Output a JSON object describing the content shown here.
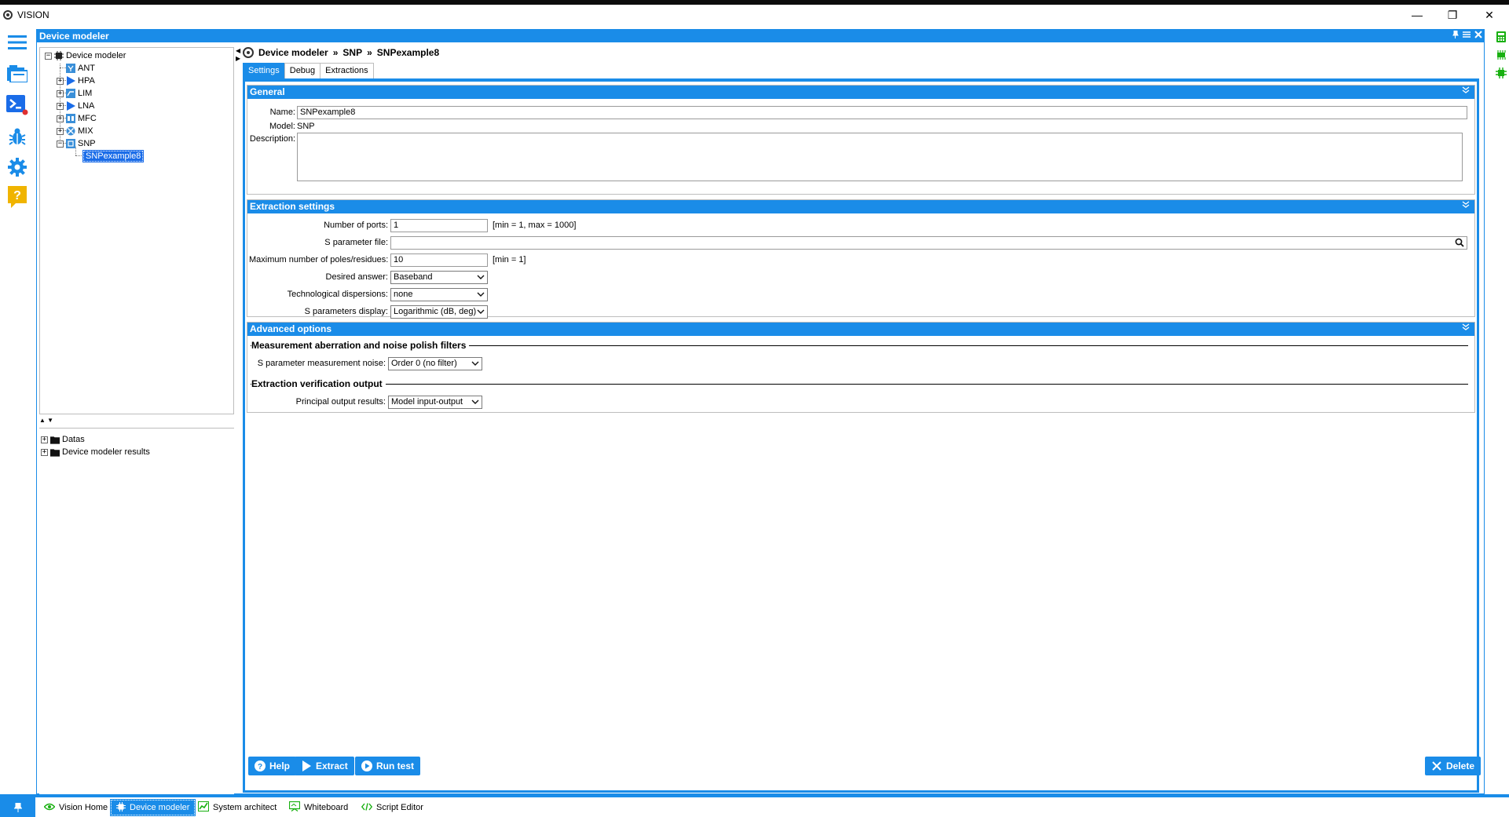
{
  "window": {
    "title": "VISION",
    "minimize": "—",
    "restore": "❐",
    "close": "✕"
  },
  "colors": {
    "accent": "#1a8ce8",
    "selection": "#1a6ce8",
    "warning": "#f0b400",
    "green": "#18b010"
  },
  "sidebar_icons": [
    "menu-icon",
    "folders-icon",
    "terminal-icon",
    "bug-icon",
    "gear-icon",
    "help-icon"
  ],
  "rightbar_icons": [
    "calculator-icon",
    "chip-icon",
    "component-icon"
  ],
  "panel": {
    "title": "Device modeler"
  },
  "tree": {
    "root": "Device modeler",
    "items": [
      {
        "label": "ANT",
        "icon": "ant-icon",
        "expander": ""
      },
      {
        "label": "HPA",
        "icon": "amplifier-icon",
        "expander": "+"
      },
      {
        "label": "LIM",
        "icon": "limiter-icon",
        "expander": "+"
      },
      {
        "label": "LNA",
        "icon": "amplifier-icon",
        "expander": "+"
      },
      {
        "label": "MFC",
        "icon": "mfc-icon",
        "expander": "+"
      },
      {
        "label": "MIX",
        "icon": "mixer-icon",
        "expander": "+"
      },
      {
        "label": "SNP",
        "icon": "snp-icon",
        "expander": "−"
      }
    ],
    "selected_child": "SNPexample8"
  },
  "results_tree": {
    "items": [
      {
        "label": "Datas"
      },
      {
        "label": "Device modeler results"
      }
    ]
  },
  "breadcrumb": {
    "part1": "Device modeler",
    "sep": "»",
    "part2": "SNP",
    "part3": "SNPexample8"
  },
  "tabs": {
    "settings": "Settings",
    "debug": "Debug",
    "extractions": "Extractions"
  },
  "general": {
    "title": "General",
    "name_label": "Name:",
    "name_value": "SNPexample8",
    "model_label": "Model:",
    "model_value": "SNP",
    "description_label": "Description:",
    "description_value": ""
  },
  "extraction": {
    "title": "Extraction settings",
    "ports_label": "Number of ports:",
    "ports_value": "1",
    "ports_hint": "[min = 1, max = 1000]",
    "sfile_label": "S parameter file:",
    "sfile_value": "",
    "poles_label": "Maximum number of poles/residues:",
    "poles_value": "10",
    "poles_hint": "[min = 1]",
    "answer_label": "Desired answer:",
    "answer_value": "Baseband",
    "disp_label": "Technological dispersions:",
    "disp_value": "none",
    "sdisplay_label": "S parameters display:",
    "sdisplay_value": "Logarithmic (dB, deg)"
  },
  "advanced": {
    "title": "Advanced options",
    "section1": "Measurement aberration and noise polish filters",
    "noise_label": "S parameter measurement noise:",
    "noise_value": "Order 0 (no filter)",
    "section2": "Extraction verification output",
    "output_label": "Principal output results:",
    "output_value": "Model input-output"
  },
  "buttons": {
    "help": "Help",
    "extract": "Extract",
    "run_test": "Run test",
    "delete": "Delete"
  },
  "taskbar": {
    "home": "Vision Home",
    "device_modeler": "Device modeler",
    "system_architect": "System architect",
    "whiteboard": "Whiteboard",
    "script_editor": "Script Editor"
  }
}
